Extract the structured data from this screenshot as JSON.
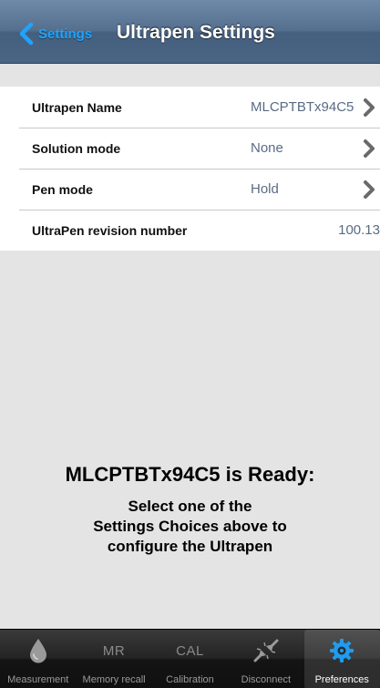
{
  "navbar": {
    "back_label": "Settings",
    "title": "Ultrapen Settings"
  },
  "settings": {
    "rows": [
      {
        "label": "Ultrapen Name",
        "value": "MLCPTBTx94C5"
      },
      {
        "label": "Solution mode",
        "value": "None"
      },
      {
        "label": "Pen mode",
        "value": "Hold"
      },
      {
        "label": "UltraPen revision number",
        "value": "100.13"
      }
    ]
  },
  "ready": {
    "title": "MLCPTBTx94C5 is Ready:",
    "body": "Select one of the\nSettings Choices above to\nconfigure the Ultrapen"
  },
  "tabbar": {
    "tabs": [
      {
        "label": "Measurement",
        "icon": "water-drop-icon"
      },
      {
        "label": "Memory recall",
        "icon_text": "MR"
      },
      {
        "label": "Calibration",
        "icon_text": "CAL"
      },
      {
        "label": "Disconnect",
        "icon": "disconnect-icon"
      },
      {
        "label": "Preferences",
        "icon": "gear-icon",
        "active": true
      }
    ]
  },
  "colors": {
    "back_accent": "#1fa3ff",
    "value_text": "#5a6b85",
    "gear_accent": "#1e9cf0"
  }
}
